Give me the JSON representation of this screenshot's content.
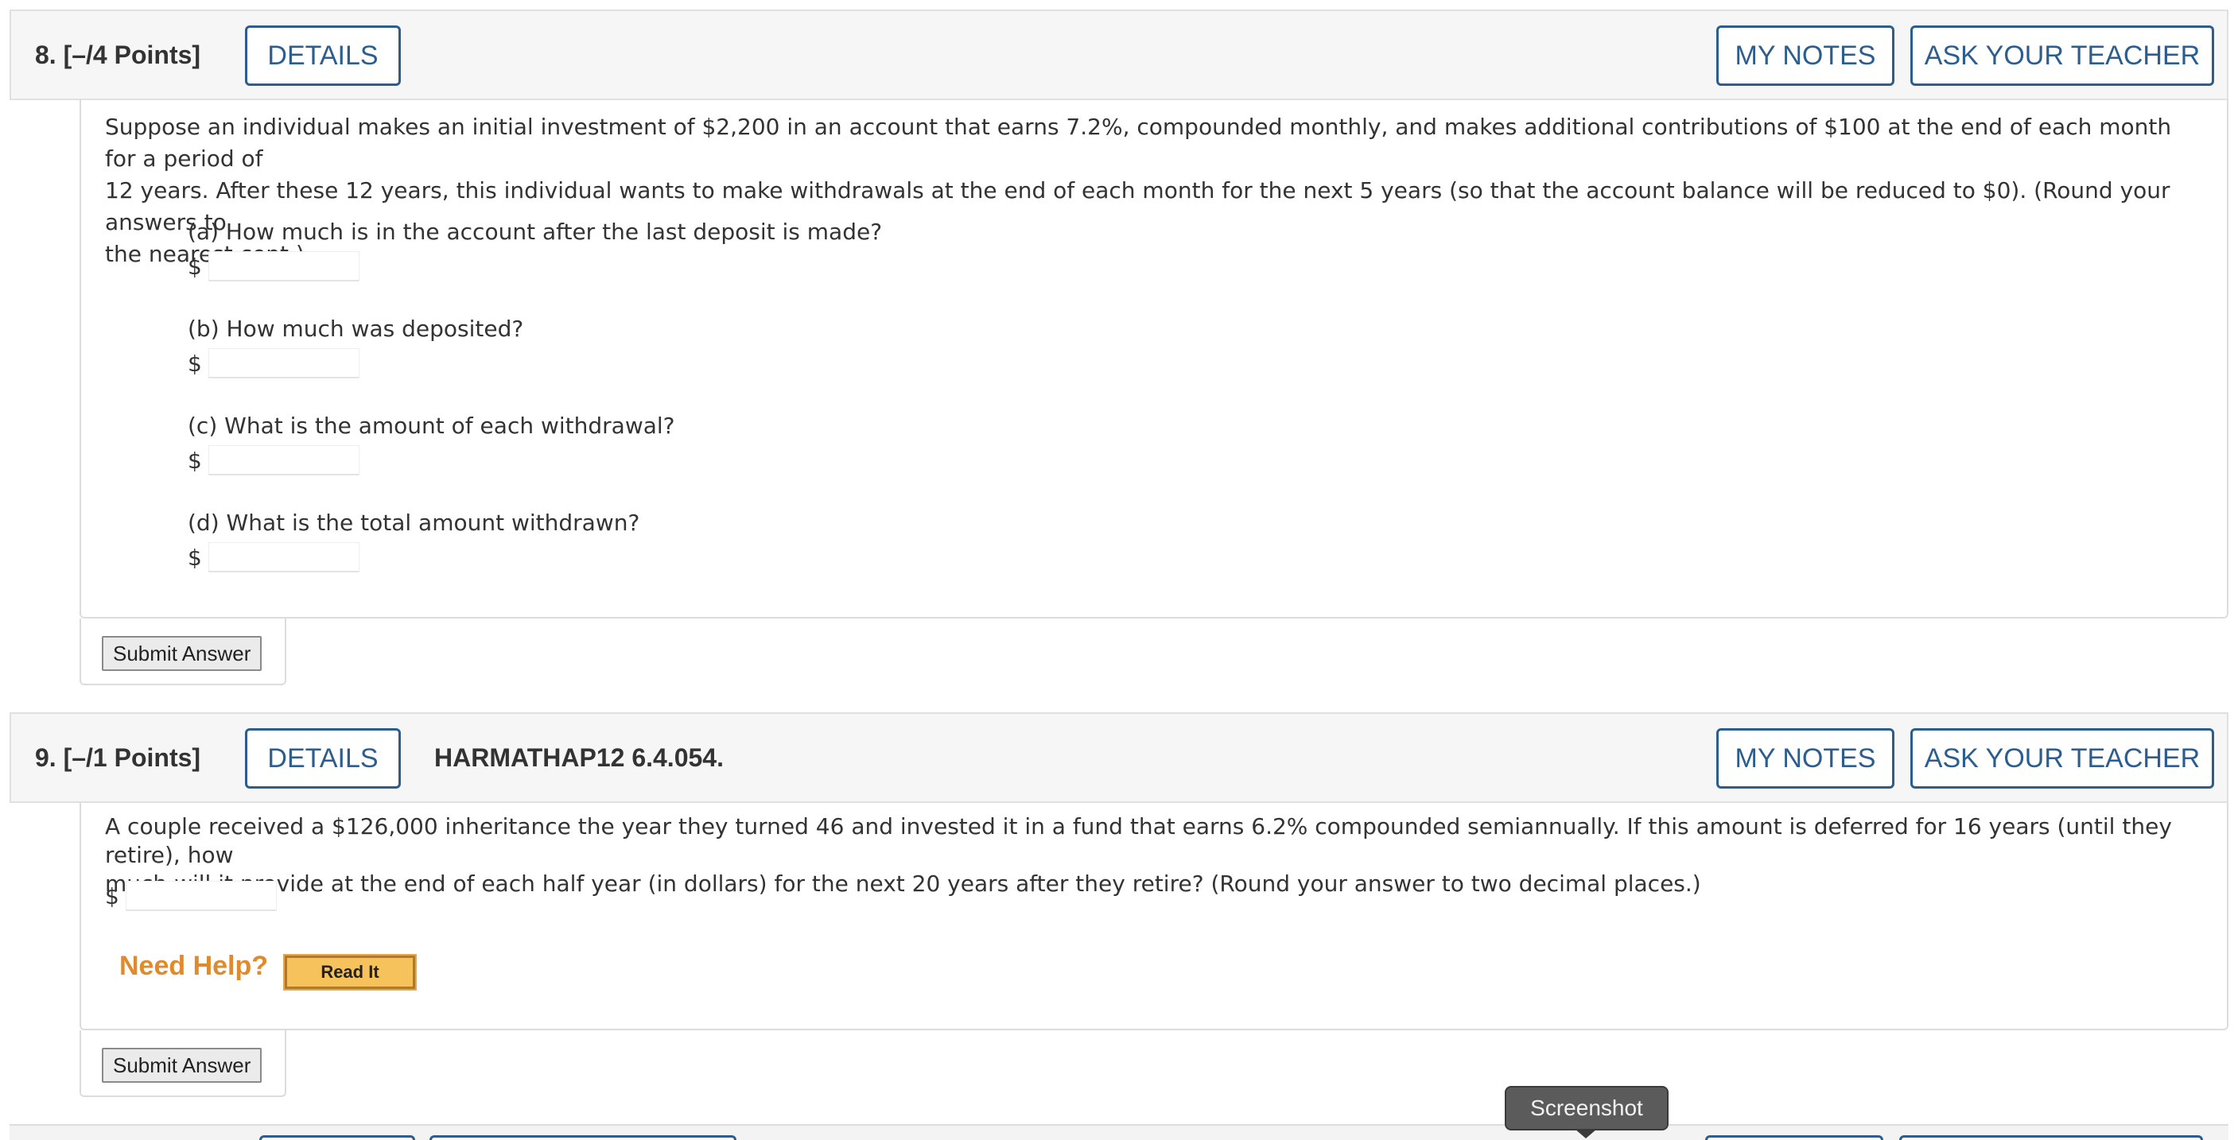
{
  "q8": {
    "number": "8.",
    "points": "[–/4 Points]",
    "details_label": "DETAILS",
    "my_notes_label": "MY NOTES",
    "ask_teacher_label": "ASK YOUR TEACHER",
    "text_lines": [
      "Suppose an individual makes an initial investment of $2,200 in an account that earns 7.2%, compounded monthly, and makes additional contributions of $100 at the end of each month for a period of",
      "12 years. After these 12 years, this individual wants to make withdrawals at the end of each month for the next 5 years (so that the account balance will be reduced to $0). (Round your answers to",
      "the nearest cent.)"
    ],
    "parts": [
      {
        "label": "(a) How much is in the account after the last deposit is made?",
        "prefix": "$",
        "value": ""
      },
      {
        "label": "(b) How much was deposited?",
        "prefix": "$",
        "value": ""
      },
      {
        "label": "(c) What is the amount of each withdrawal?",
        "prefix": "$",
        "value": ""
      },
      {
        "label": "(d) What is the total amount withdrawn?",
        "prefix": "$",
        "value": ""
      }
    ],
    "submit_label": "Submit Answer"
  },
  "q9": {
    "number": "9.",
    "points": "[–/1 Points]",
    "details_label": "DETAILS",
    "code": "HARMATHAP12 6.4.054.",
    "my_notes_label": "MY NOTES",
    "ask_teacher_label": "ASK YOUR TEACHER",
    "text_lines": [
      "A couple received a $126,000 inheritance the year they turned 46 and invested it in a fund that earns 6.2% compounded semiannually. If this amount is deferred for 16 years (until they retire), how",
      "much will it provide at the end of each half year (in dollars) for the next 20 years after they retire? (Round your answer to two decimal places.)"
    ],
    "answer_prefix": "$",
    "answer_value": "",
    "need_help_label": "Need Help?",
    "read_it_label": "Read It",
    "submit_label": "Submit Answer"
  },
  "tooltip": {
    "label": "Screenshot"
  },
  "colors": {
    "link_blue": "#2c5d8f",
    "need_help_orange": "#e08a2e",
    "read_it_bg": "#f6c25b"
  }
}
